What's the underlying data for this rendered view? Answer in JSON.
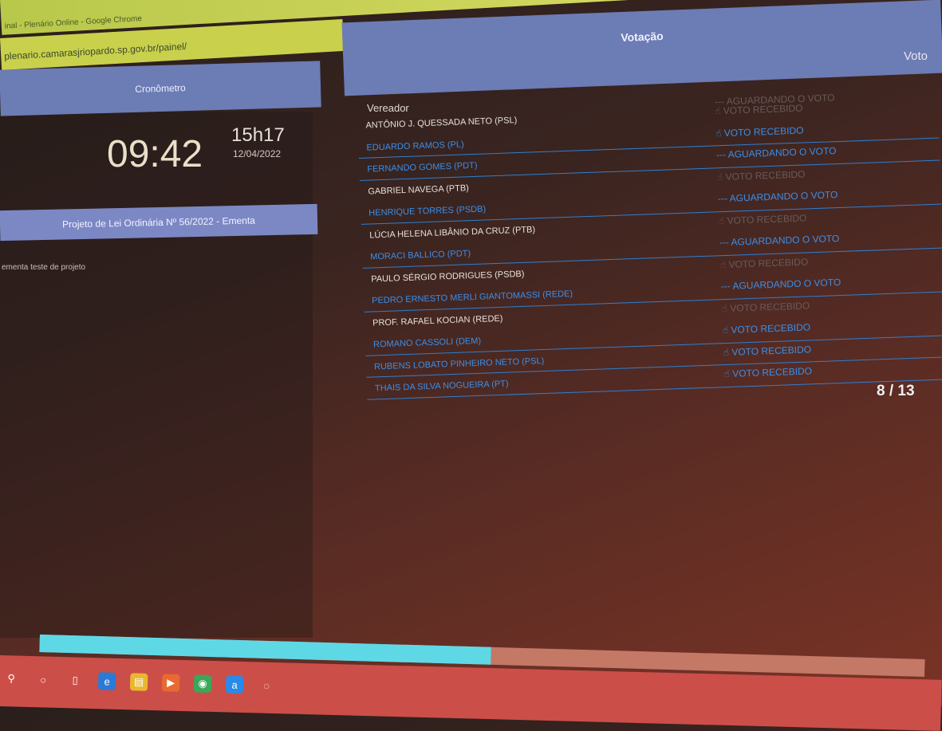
{
  "browser": {
    "title": "inal - Plenário Online - Google Chrome",
    "url": "plenario.camarasjriopardo.sp.gov.br/painel/"
  },
  "cronometro": {
    "header": "Cronômetro",
    "timer": "09:42",
    "time": "15h17",
    "date": "12/04/2022"
  },
  "projeto": {
    "title": "Projeto de Lei Ordinária Nº 56/2022 - Ementa",
    "description": "ementa teste de projeto"
  },
  "votacao": {
    "header": "Votação",
    "vote_column": "Voto",
    "vereador_column": "Vereador",
    "header_status": "--- AGUARDANDO O VOTO",
    "rows": [
      {
        "name": "ANTÔNIO J. QUESSADA NETO (PSL)",
        "status": "☝ VOTO RECEBIDO",
        "state": "waiting"
      },
      {
        "name": "EDUARDO RAMOS (PL)",
        "status": "☝ VOTO RECEBIDO",
        "state": "voted"
      },
      {
        "name": "FERNANDO GOMES (PDT)",
        "status": "--- AGUARDANDO O VOTO",
        "state": "voted"
      },
      {
        "name": "GABRIEL NAVEGA (PTB)",
        "status": "☝ VOTO RECEBIDO",
        "state": "waiting"
      },
      {
        "name": "HENRIQUE TORRES (PSDB)",
        "status": "--- AGUARDANDO O VOTO",
        "state": "voted"
      },
      {
        "name": "LÚCIA HELENA LIBÂNIO DA CRUZ (PTB)",
        "status": "☝ VOTO RECEBIDO",
        "state": "waiting"
      },
      {
        "name": "MORACI BALLICO (PDT)",
        "status": "--- AGUARDANDO O VOTO",
        "state": "voted"
      },
      {
        "name": "PAULO SÉRGIO RODRIGUES (PSDB)",
        "status": "☝ VOTO RECEBIDO",
        "state": "waiting"
      },
      {
        "name": "PEDRO ERNESTO MERLI GIANTOMASSI (REDE)",
        "status": "--- AGUARDANDO O VOTO",
        "state": "voted"
      },
      {
        "name": "PROF. RAFAEL KOCIAN (REDE)",
        "status": "☝ VOTO RECEBIDO",
        "state": "waiting"
      },
      {
        "name": "ROMANO CASSOLI (DEM)",
        "status": "☝ VOTO RECEBIDO",
        "state": "voted"
      },
      {
        "name": "RUBENS LOBATO PINHEIRO NETO (PSL)",
        "status": "☝ VOTO RECEBIDO",
        "state": "voted"
      },
      {
        "name": "THAIS DA SILVA NOGUEIRA (PT)",
        "status": "☝ VOTO RECEBIDO",
        "state": "voted"
      }
    ],
    "count": "8 / 13"
  },
  "progress": {
    "fraction": 0.51
  },
  "taskbar": {
    "icons": [
      "search-icon",
      "cortana-icon",
      "task-view-icon",
      "edge-icon",
      "file-explorer-icon",
      "media-player-icon",
      "chrome-icon",
      "app-a-icon",
      "obs-icon"
    ]
  },
  "colors": {
    "header_blue": "#6c7cb4",
    "voted_blue": "#3a8fe8",
    "progress_cyan": "#5fd8e6"
  }
}
